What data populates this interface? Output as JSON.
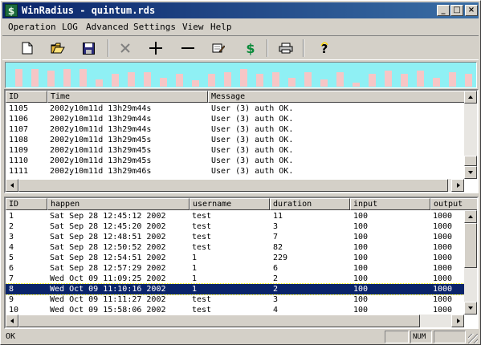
{
  "window": {
    "title": "WinRadius - quintum.rds",
    "icon_letter": "$",
    "controls": [
      "_",
      "□",
      "×"
    ]
  },
  "menu": [
    "Operation",
    "LOG",
    "Advanced",
    "Settings",
    "View",
    "Help"
  ],
  "toolbar": {
    "icons": [
      "new-file-icon",
      "open-folder-icon",
      "save-icon",
      "delete-x-icon",
      "add-plus-icon",
      "remove-minus-icon",
      "edit-note-icon",
      "dollar-icon",
      "print-icon",
      "help-question-icon"
    ],
    "accent_color": "#8ff0f4",
    "bar_color": "#f6c6c6"
  },
  "traffic_graph": {
    "levels": [
      0.72,
      0.72,
      0.66,
      0.72,
      0.72,
      0.29,
      0.5,
      0.57,
      0.57,
      0.36,
      0.5,
      0.27,
      0.5,
      0.57,
      0.72,
      0.5,
      0.57,
      0.36,
      0.57,
      0.3,
      0.57,
      0.15,
      0.5,
      0.66,
      0.5,
      0.66,
      0.36,
      0.57,
      0.5,
      0.43,
      0.57,
      0.43,
      0.57
    ]
  },
  "log": {
    "columns": [
      "ID",
      "Time",
      "Message"
    ],
    "rows": [
      [
        "1105",
        "2002y10m11d 13h29m44s",
        "User (3) auth OK."
      ],
      [
        "1106",
        "2002y10m11d 13h29m44s",
        "User (3) auth OK."
      ],
      [
        "1107",
        "2002y10m11d 13h29m44s",
        "User (3) auth OK."
      ],
      [
        "1108",
        "2002y10m11d 13h29m45s",
        "User (3) auth OK."
      ],
      [
        "1109",
        "2002y10m11d 13h29m45s",
        "User (3) auth OK."
      ],
      [
        "1110",
        "2002y10m11d 13h29m45s",
        "User (3) auth OK."
      ],
      [
        "1111",
        "2002y10m11d 13h29m46s",
        "User (3) auth OK."
      ]
    ]
  },
  "sessions": {
    "columns": [
      "ID",
      "happen",
      "username",
      "duration",
      "input",
      "output"
    ],
    "selected_index": 7,
    "rows": [
      [
        "1",
        "Sat Sep 28 12:45:12 2002",
        "test",
        "11",
        "100",
        "1000"
      ],
      [
        "2",
        "Sat Sep 28 12:45:20 2002",
        "test",
        "3",
        "100",
        "1000"
      ],
      [
        "3",
        "Sat Sep 28 12:48:51 2002",
        "test",
        "7",
        "100",
        "1000"
      ],
      [
        "4",
        "Sat Sep 28 12:50:52 2002",
        "test",
        "82",
        "100",
        "1000"
      ],
      [
        "5",
        "Sat Sep 28 12:54:51 2002",
        "1",
        "229",
        "100",
        "1000"
      ],
      [
        "6",
        "Sat Sep 28 12:57:29 2002",
        "1",
        "6",
        "100",
        "1000"
      ],
      [
        "7",
        "Wed Oct 09 11:09:25 2002",
        "1",
        "2",
        "100",
        "1000"
      ],
      [
        "8",
        "Wed Oct 09 11:10:16 2002",
        "1",
        "2",
        "100",
        "1000"
      ],
      [
        "9",
        "Wed Oct 09 11:11:27 2002",
        "test",
        "3",
        "100",
        "1000"
      ],
      [
        "10",
        "Wed Oct 09 15:58:06 2002",
        "test",
        "4",
        "100",
        "1000"
      ]
    ]
  },
  "status": {
    "text": "OK",
    "panels": [
      "",
      "NUM",
      ""
    ]
  }
}
